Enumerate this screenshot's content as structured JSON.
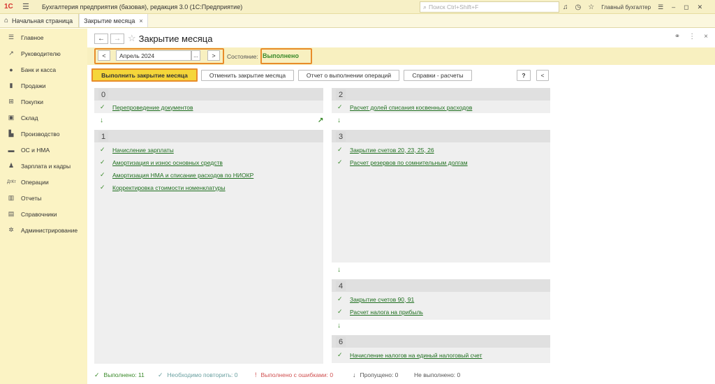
{
  "topbar": {
    "logo": "1С",
    "app_title": "Бухгалтерия предприятия (базовая), редакция 3.0  (1С:Предприятие)",
    "search_placeholder": "Поиск Ctrl+Shift+F",
    "user": "Главный бухгалтер"
  },
  "tabs": {
    "home": "Начальная страница",
    "active": "Закрытие месяца"
  },
  "sidebar": {
    "items": [
      {
        "label": "Главное",
        "icon": "list-icon"
      },
      {
        "label": "Руководителю",
        "icon": "trend-icon"
      },
      {
        "label": "Банк и касса",
        "icon": "coin-icon"
      },
      {
        "label": "Продажи",
        "icon": "bag-icon"
      },
      {
        "label": "Покупки",
        "icon": "cart-icon"
      },
      {
        "label": "Склад",
        "icon": "box-icon"
      },
      {
        "label": "Производство",
        "icon": "factory-icon"
      },
      {
        "label": "ОС и НМА",
        "icon": "truck-icon"
      },
      {
        "label": "Зарплата и кадры",
        "icon": "person-icon"
      },
      {
        "label": "Операции",
        "icon": "dt-kt-icon"
      },
      {
        "label": "Отчеты",
        "icon": "chart-icon"
      },
      {
        "label": "Справочники",
        "icon": "book-icon"
      },
      {
        "label": "Администрирование",
        "icon": "gear-icon"
      }
    ]
  },
  "page": {
    "title": "Закрытие месяца",
    "period": "Апрель 2024",
    "state_label": "Состояние:",
    "state_value": "Выполнено",
    "buttons": {
      "run": "Выполнить закрытие месяца",
      "cancel": "Отменить закрытие месяца",
      "report": "Отчет о выполнении операций",
      "refs": "Справки - расчеты",
      "help": "?",
      "collapse": "<"
    },
    "prev": "<",
    "next": ">",
    "dots": "..."
  },
  "stages": [
    {
      "num": "0",
      "ops": [
        "Перепроведение документов"
      ]
    },
    {
      "num": "1",
      "ops": [
        "Начисление зарплаты",
        "Амортизация и износ основных средств",
        "Амортизация НМА и списание расходов по НИОКР",
        "Корректировка стоимости номенклатуры"
      ]
    },
    {
      "num": "2",
      "ops": [
        "Расчет долей списания косвенных расходов"
      ]
    },
    {
      "num": "3",
      "ops": [
        "Закрытие счетов 20, 23, 25, 26",
        "Расчет резервов по сомнительным долгам"
      ]
    },
    {
      "num": "4",
      "ops": [
        "Закрытие счетов 90, 91",
        "Расчет налога на прибыль"
      ]
    },
    {
      "num": "6",
      "ops": [
        "Начисление налогов на единый налоговый счет"
      ]
    }
  ],
  "status": {
    "done": "Выполнено: 11",
    "repeat": "Необходимо повторить: 0",
    "errors": "Выполнено с ошибками: 0",
    "skipped": "Пропущено: 0",
    "not_done": "Не выполнено: 0"
  },
  "colors": {
    "accent_yellow": "#f5d63a",
    "highlight_orange": "#e88c2a",
    "done_green": "#3a8a2a",
    "sidebar_bg": "#fbf3c4"
  }
}
